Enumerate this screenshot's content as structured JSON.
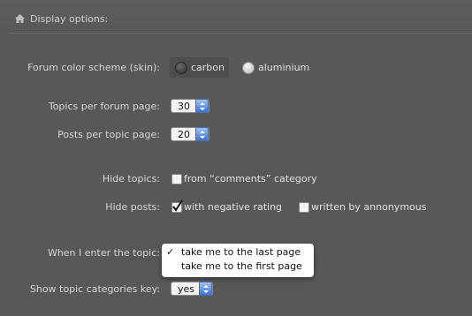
{
  "header": {
    "title": "Display options:",
    "icon": "house-icon"
  },
  "skin": {
    "label": "Forum color scheme (skin):",
    "options": [
      "carbon",
      "aluminium"
    ],
    "selected": "carbon"
  },
  "topics_per_page": {
    "label": "Topics per forum page:",
    "value": "30"
  },
  "posts_per_page": {
    "label": "Posts per topic page:",
    "value": "20"
  },
  "hide_topics": {
    "label": "Hide topics:",
    "option": "from “comments” category",
    "checked": false
  },
  "hide_posts": {
    "label": "Hide posts:",
    "options": [
      {
        "label": "with negative rating",
        "checked": true
      },
      {
        "label": "written by annonymous",
        "checked": false
      }
    ]
  },
  "enter_topic": {
    "label": "When I enter the topic:",
    "options": [
      "take me to the last page",
      "take me to the first page"
    ],
    "selected": "take me to the last page",
    "check_mark": "✓"
  },
  "categories_key": {
    "label": "Show topic categories key:",
    "value": "yes"
  }
}
